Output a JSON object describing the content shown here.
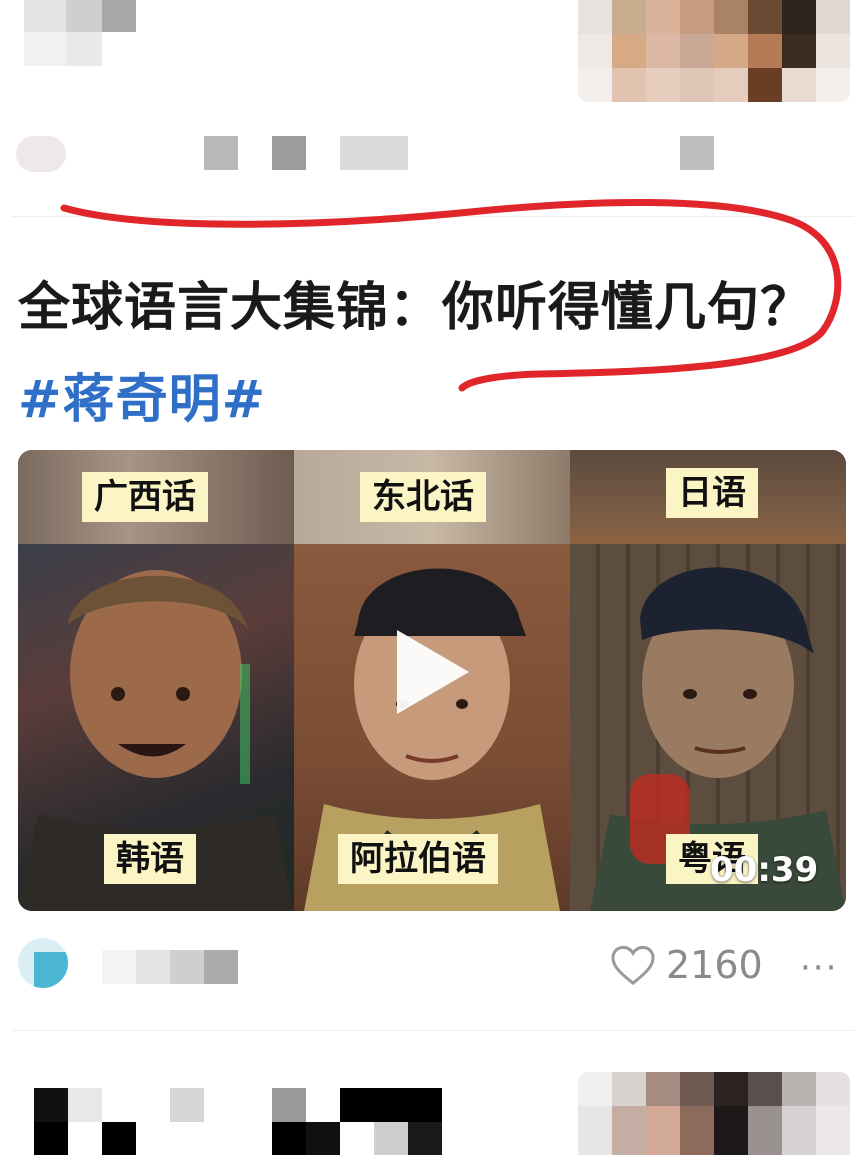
{
  "post": {
    "title_text": "全球语言大集锦：你听得懂几句？",
    "hashtag": "#蒋奇明#"
  },
  "video": {
    "labels_top": [
      "广西话",
      "东北话",
      "日语"
    ],
    "labels_bottom": [
      "韩语",
      "阿拉伯语",
      "粤语"
    ],
    "duration": "00:39"
  },
  "footer": {
    "likes": "2160",
    "more": "···"
  },
  "icons": {
    "like": "heart-outline-icon",
    "play": "play-icon",
    "more": "more-dots-icon"
  },
  "colors": {
    "hashtag": "#2f6fc7",
    "annotation": "#e0262a",
    "label_bg": "#fbf5c6"
  }
}
